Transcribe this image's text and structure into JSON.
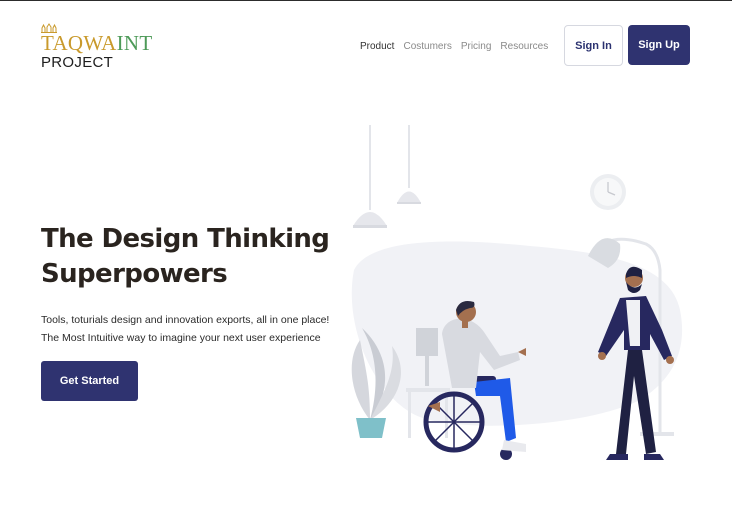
{
  "brand": {
    "line1_part1": "TAQWA",
    "line1_part2": "INT",
    "line2": "PROJECT"
  },
  "nav": [
    {
      "label": "Product",
      "active": true
    },
    {
      "label": "Costumers",
      "active": false
    },
    {
      "label": "Pricing",
      "active": false
    },
    {
      "label": "Resources",
      "active": false
    }
  ],
  "auth": {
    "signin_label": "Sign In",
    "signup_label": "Sign Up"
  },
  "hero": {
    "title_line1": "The Design Thinking",
    "title_line2": "Superpowers",
    "subtitle_line1": "Tools, toturials design and innovation exports, all in one place!",
    "subtitle_line2": "The Most Intuitive way to imagine your next user experience",
    "cta_label": "Get Started"
  },
  "colors": {
    "primary": "#2f3370",
    "logo_gold": "#c99a2c",
    "logo_green": "#4d9a58",
    "headline": "#2a241f"
  },
  "icons": [
    "logo-mark-icon"
  ]
}
